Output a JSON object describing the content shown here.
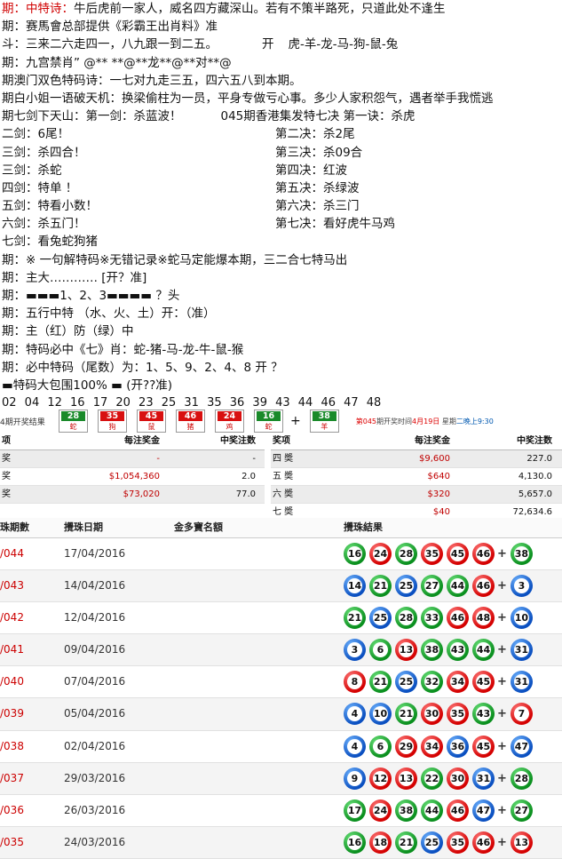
{
  "lines": {
    "l1": {
      "a": "期：",
      "b": "中特诗：",
      "c": "牛后虎前一家人，威名四方藏深山。若有不策半路死，只道此处不逢生"
    },
    "l2": "期：赛馬會总部提供《彩霸王出肖料》准",
    "l3": {
      "a": "斗：三来二六走四一，八九跟一到二五。",
      "b": "开",
      "c": "虎-羊-龙-马-狗-鼠-兔"
    },
    "l4": "期：九宫禁肖” @** **@**龙**@**对**@",
    "l5": "期澳门双色特码诗：一七对九走三五，四六五八到本期。",
    "l6": "期白小姐一语破天机：换梁偷柱为一员，平身专做亏心事。多少人家积怨气，遇者举手我慌逃",
    "l7": {
      "a": "期七剑下天山：第一剑：杀蓝波！",
      "b": "045期香港集发特七决 第一诀：杀虎"
    },
    "pairs": [
      {
        "l": "二剑：6尾！",
        "r": "第二决：杀2尾"
      },
      {
        "l": "三剑：杀四合！",
        "r": "第三决：杀09合"
      },
      {
        "l": "三剑：杀蛇",
        "r": "第四决：红波"
      },
      {
        "l": "四剑：特单 ！",
        "r": "第五决：杀绿波"
      },
      {
        "l": "五剑：特看小数！",
        "r": "第六决：杀三门"
      },
      {
        "l": "六剑：杀五门！",
        "r": "第七决：看好虎牛马鸡"
      }
    ],
    "l14": "七剑：看兔蛇狗猪",
    "l15": "期：※ 一句解特码※无错记录※蛇马定能爆本期，三二合七特马出",
    "l16": "期：主大………… [开？准]",
    "l17": "期：▬▬▬1、2、3▬▬▬▬ ？头",
    "l18": "期：五行中特  （水、火、土）开：（准）",
    "l19": "期：主（红）防（绿）中",
    "l20": "期：特码必中《七》肖：蛇-猪-马-龙-牛-鼠-猴",
    "l21": "期：必中特码（尾数）为：1、5、9、2、4、8      开 ？",
    "l22": "▬特码大包围100% ▬    (开??准)",
    "numbers": "02 04 12 16 17 20 23 25 31 35 36 39 43 44 46 47 48"
  },
  "draw": {
    "label": "4期开奖结果",
    "balls": [
      {
        "n": "28",
        "z": "蛇",
        "c": "#1a8a2a"
      },
      {
        "n": "35",
        "z": "狗",
        "c": "#d81010"
      },
      {
        "n": "45",
        "z": "鼠",
        "c": "#d81010"
      },
      {
        "n": "46",
        "z": "猪",
        "c": "#d81010"
      },
      {
        "n": "24",
        "z": "鸡",
        "c": "#d81010"
      },
      {
        "n": "16",
        "z": "蛇",
        "c": "#1a8a2a"
      }
    ],
    "plus": "+",
    "special": {
      "n": "38",
      "z": "羊",
      "c": "#1a8a2a"
    },
    "info": {
      "a": "第",
      "b": "045",
      "c": "期开奖时间",
      "d": "4月19日",
      "e": "星期",
      "f": "二晚上9:30"
    }
  },
  "prize_left": {
    "headers": [
      "项",
      "每注奖金",
      "中奖注数"
    ],
    "rows": [
      {
        "name": "奖",
        "amount": "-",
        "count": "-"
      },
      {
        "name": "奖",
        "amount": "$1,054,360",
        "count": "2.0"
      },
      {
        "name": "奖",
        "amount": "$73,020",
        "count": "77.0"
      }
    ]
  },
  "prize_right": {
    "headers": [
      "奖项",
      "每注奖金",
      "中奖注数"
    ],
    "rows": [
      {
        "name": "四 奬",
        "amount": "$9,600",
        "count": "227.0"
      },
      {
        "name": "五 奬",
        "amount": "$640",
        "count": "4,130.0"
      },
      {
        "name": "六 奬",
        "amount": "$320",
        "count": "5,657.0"
      },
      {
        "name": "七 奬",
        "amount": "$40",
        "count": "72,634.6"
      }
    ]
  },
  "history": {
    "headers": {
      "issue": "珠期數",
      "date": "攪珠日期",
      "jackpot": "金多寶名額",
      "result": "攪珠結果"
    },
    "rows": [
      {
        "issue": "/044",
        "date": "17/04/2016",
        "balls": [
          [
            "16",
            "g"
          ],
          [
            "24",
            "r"
          ],
          [
            "28",
            "g"
          ],
          [
            "35",
            "r"
          ],
          [
            "45",
            "r"
          ],
          [
            "46",
            "r"
          ]
        ],
        "sp": [
          "38",
          "g"
        ]
      },
      {
        "issue": "/043",
        "date": "14/04/2016",
        "balls": [
          [
            "14",
            "b"
          ],
          [
            "21",
            "g"
          ],
          [
            "25",
            "b"
          ],
          [
            "27",
            "g"
          ],
          [
            "44",
            "g"
          ],
          [
            "46",
            "r"
          ]
        ],
        "sp": [
          "3",
          "b"
        ]
      },
      {
        "issue": "/042",
        "date": "12/04/2016",
        "balls": [
          [
            "21",
            "g"
          ],
          [
            "25",
            "b"
          ],
          [
            "28",
            "g"
          ],
          [
            "33",
            "g"
          ],
          [
            "46",
            "r"
          ],
          [
            "48",
            "r"
          ]
        ],
        "sp": [
          "10",
          "b"
        ]
      },
      {
        "issue": "/041",
        "date": "09/04/2016",
        "balls": [
          [
            "3",
            "b"
          ],
          [
            "6",
            "g"
          ],
          [
            "13",
            "r"
          ],
          [
            "38",
            "g"
          ],
          [
            "43",
            "g"
          ],
          [
            "44",
            "g"
          ]
        ],
        "sp": [
          "31",
          "b"
        ]
      },
      {
        "issue": "/040",
        "date": "07/04/2016",
        "balls": [
          [
            "8",
            "r"
          ],
          [
            "21",
            "g"
          ],
          [
            "25",
            "b"
          ],
          [
            "32",
            "g"
          ],
          [
            "34",
            "r"
          ],
          [
            "45",
            "r"
          ]
        ],
        "sp": [
          "31",
          "b"
        ]
      },
      {
        "issue": "/039",
        "date": "05/04/2016",
        "balls": [
          [
            "4",
            "b"
          ],
          [
            "10",
            "b"
          ],
          [
            "21",
            "g"
          ],
          [
            "30",
            "r"
          ],
          [
            "35",
            "r"
          ],
          [
            "43",
            "g"
          ]
        ],
        "sp": [
          "7",
          "r"
        ]
      },
      {
        "issue": "/038",
        "date": "02/04/2016",
        "balls": [
          [
            "4",
            "b"
          ],
          [
            "6",
            "g"
          ],
          [
            "29",
            "r"
          ],
          [
            "34",
            "r"
          ],
          [
            "36",
            "b"
          ],
          [
            "45",
            "r"
          ]
        ],
        "sp": [
          "47",
          "b"
        ]
      },
      {
        "issue": "/037",
        "date": "29/03/2016",
        "balls": [
          [
            "9",
            "b"
          ],
          [
            "12",
            "r"
          ],
          [
            "13",
            "r"
          ],
          [
            "22",
            "g"
          ],
          [
            "30",
            "r"
          ],
          [
            "31",
            "b"
          ]
        ],
        "sp": [
          "28",
          "g"
        ]
      },
      {
        "issue": "/036",
        "date": "26/03/2016",
        "balls": [
          [
            "17",
            "g"
          ],
          [
            "24",
            "r"
          ],
          [
            "38",
            "g"
          ],
          [
            "44",
            "g"
          ],
          [
            "46",
            "r"
          ],
          [
            "47",
            "b"
          ]
        ],
        "sp": [
          "27",
          "g"
        ]
      },
      {
        "issue": "/035",
        "date": "24/03/2016",
        "balls": [
          [
            "16",
            "g"
          ],
          [
            "18",
            "r"
          ],
          [
            "21",
            "g"
          ],
          [
            "25",
            "b"
          ],
          [
            "35",
            "r"
          ],
          [
            "46",
            "r"
          ]
        ],
        "sp": [
          "13",
          "r"
        ]
      }
    ]
  }
}
